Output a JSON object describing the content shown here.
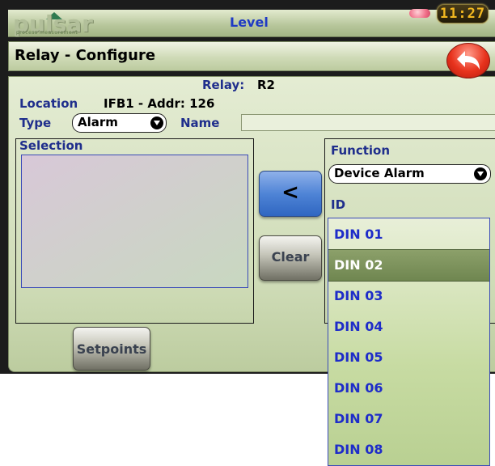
{
  "header": {
    "logo_text": "pulsar",
    "logo_tagline": "process measurement",
    "title": "Level",
    "clock": "11:27"
  },
  "page_title": "Relay - Configure",
  "relay": {
    "label": "Relay:",
    "value": "R2"
  },
  "location": {
    "label": "Location",
    "value": "IFB1 - Addr: 126"
  },
  "type": {
    "label": "Type",
    "value": "Alarm"
  },
  "name": {
    "label": "Name",
    "value": ""
  },
  "selection": {
    "label": "Selection"
  },
  "buttons": {
    "move_left": "<",
    "clear": "Clear",
    "setpoints": "Setpoints"
  },
  "function": {
    "label": "Function",
    "value": "Device Alarm"
  },
  "id": {
    "label": "ID",
    "selected": "DIN 02",
    "items": [
      "DIN 01",
      "DIN 02",
      "DIN 03",
      "DIN 04",
      "DIN 05",
      "DIN 06",
      "DIN 07",
      "DIN 08"
    ]
  },
  "colors": {
    "label_blue": "#1f2e8c",
    "list_blue": "#1e2cc9",
    "accent_blue": "#4f84d6",
    "panel_green": "#cfdcb7",
    "back_red": "#e8331d",
    "clock_amber": "#f2b820"
  }
}
